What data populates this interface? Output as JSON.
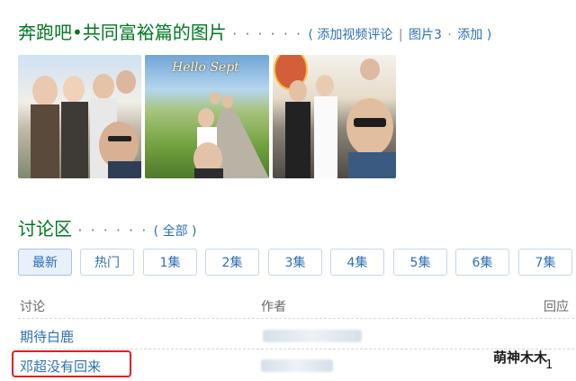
{
  "photos_section": {
    "title": "奔跑吧•共同富裕篇的图片",
    "dots": "· · · · · ·",
    "paren_open": "(",
    "add_video_review": "添加视频评论",
    "sep": "|",
    "photos_count": "图片3",
    "dot_sep": "·",
    "add": "添加",
    "paren_close": ")",
    "photos": [
      {
        "caption": ""
      },
      {
        "caption": "Hello Sept"
      },
      {
        "caption": ""
      }
    ]
  },
  "discussion_section": {
    "title": "讨论区",
    "dots": "· · · · · ·",
    "all_link": "( 全部 )",
    "tabs": [
      "最新",
      "热门",
      "1集",
      "2集",
      "3集",
      "4集",
      "5集",
      "6集",
      "7集"
    ],
    "active_tab": "最新",
    "table_headers": {
      "topic": "讨论",
      "author": "作者",
      "replies": "回应"
    },
    "rows": [
      {
        "topic": "期待白鹿",
        "author": "",
        "replies": ""
      },
      {
        "topic": "邓超没有回来",
        "author": "",
        "replies": "1"
      }
    ]
  },
  "watermark": "萌神木木",
  "colors": {
    "title_green": "#007722",
    "link_blue": "#2f6fb3",
    "highlight_red": "#e02020"
  }
}
